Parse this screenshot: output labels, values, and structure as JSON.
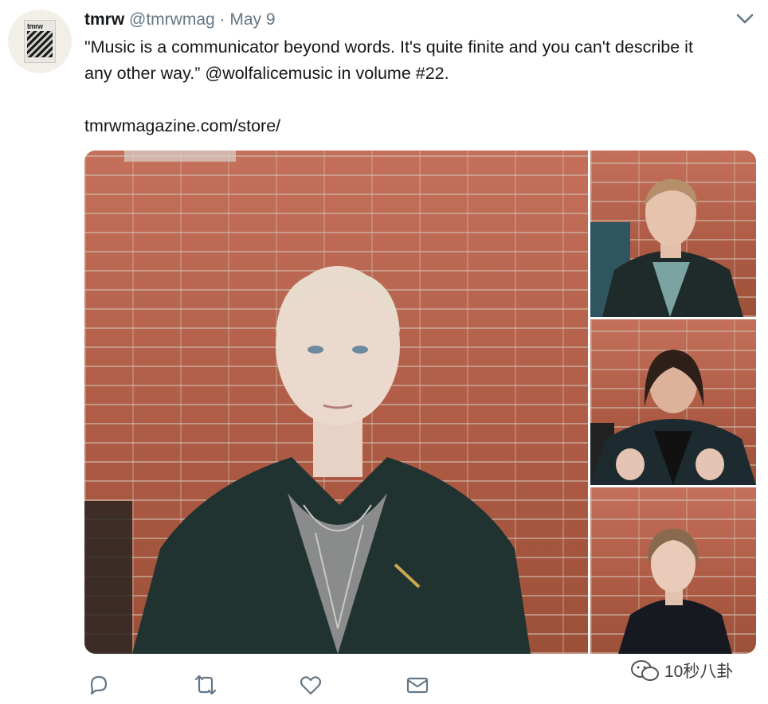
{
  "tweet": {
    "display_name": "tmrw",
    "handle": "@tmrwmag",
    "separator": "·",
    "date": "May 9",
    "text_line1": "\"Music is a communicator beyond words. It's quite finite and you can't describe it",
    "text_line2_before": "any other way.”",
    "mention": "@wolfalicemusic",
    "text_line2_after": "in volume #22.",
    "link": "tmrwmagazine.com/store/"
  },
  "avatar": {
    "cover_text": "tmrw"
  },
  "media": {
    "photos": [
      {
        "name": "main-portrait-photo"
      },
      {
        "name": "portrait-photo-2"
      },
      {
        "name": "portrait-photo-3"
      },
      {
        "name": "portrait-photo-4"
      }
    ]
  },
  "actions": [
    {
      "name": "reply",
      "icon": "reply-icon"
    },
    {
      "name": "retweet",
      "icon": "retweet-icon"
    },
    {
      "name": "like",
      "icon": "heart-icon"
    },
    {
      "name": "direct-message",
      "icon": "envelope-icon"
    }
  ],
  "watermark": {
    "text": "10秒八卦"
  },
  "colors": {
    "text": "#14171a",
    "secondary": "#657786",
    "icon": "#657786"
  }
}
